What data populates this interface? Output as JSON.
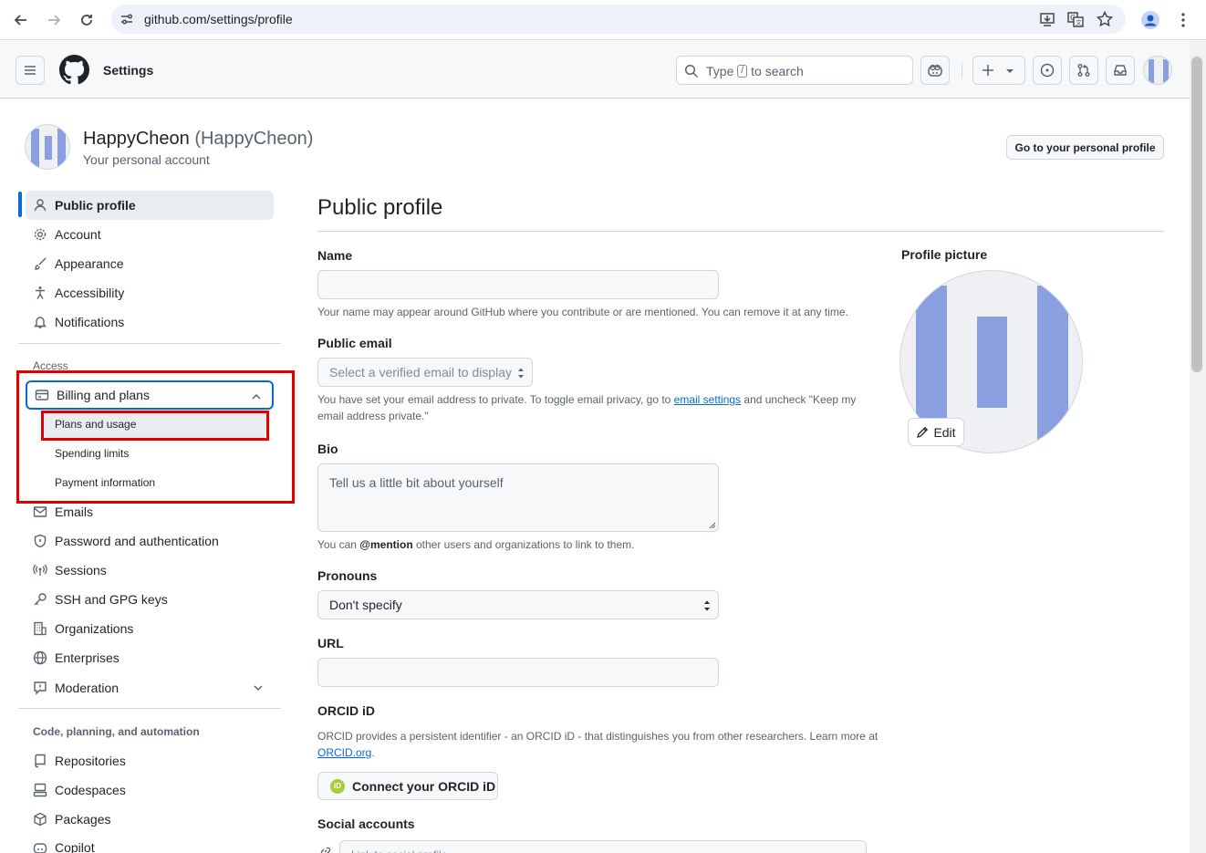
{
  "browser": {
    "url": "github.com/settings/profile"
  },
  "header": {
    "context": "Settings",
    "search_type": "Type",
    "search_key": "/",
    "search_rest": "to search"
  },
  "user": {
    "display_name": "HappyCheon",
    "login": "(HappyCheon)",
    "subtitle": "Your personal account",
    "go_profile_label": "Go to your personal profile"
  },
  "sidebar": {
    "top_items": [
      {
        "label": "Public profile",
        "icon": "person-icon"
      },
      {
        "label": "Account",
        "icon": "gear-icon"
      },
      {
        "label": "Appearance",
        "icon": "paintbrush-icon"
      },
      {
        "label": "Accessibility",
        "icon": "accessibility-icon"
      },
      {
        "label": "Notifications",
        "icon": "bell-icon"
      }
    ],
    "access_heading": "Access",
    "billing_label": "Billing and plans",
    "billing_sub": [
      "Plans and usage",
      "Spending limits",
      "Payment information"
    ],
    "access_items": [
      {
        "label": "Emails",
        "icon": "mail-icon"
      },
      {
        "label": "Password and authentication",
        "icon": "shield-lock-icon"
      },
      {
        "label": "Sessions",
        "icon": "broadcast-icon"
      },
      {
        "label": "SSH and GPG keys",
        "icon": "key-icon"
      },
      {
        "label": "Organizations",
        "icon": "organization-icon"
      },
      {
        "label": "Enterprises",
        "icon": "globe-icon"
      },
      {
        "label": "Moderation",
        "icon": "report-icon"
      }
    ],
    "code_heading": "Code, planning, and automation",
    "code_items": [
      {
        "label": "Repositories",
        "icon": "repo-icon"
      },
      {
        "label": "Codespaces",
        "icon": "codespaces-icon"
      },
      {
        "label": "Packages",
        "icon": "package-icon"
      },
      {
        "label": "Copilot",
        "icon": "copilot-icon"
      }
    ]
  },
  "main": {
    "title": "Public profile",
    "name_label": "Name",
    "name_value": "",
    "name_note": "Your name may appear around GitHub where you contribute or are mentioned. You can remove it at any time.",
    "email_label": "Public email",
    "email_select": "Select a verified email to display",
    "email_note_1": "You have set your email address to private. To toggle email privacy, go to",
    "email_note_link": "email settings",
    "email_note_2": "and uncheck \"Keep my",
    "email_note_3": "email address private.\"",
    "bio_label": "Bio",
    "bio_placeholder": "Tell us a little bit about yourself",
    "bio_note_1": "You can",
    "bio_note_mention": "@mention",
    "bio_note_2": "other users and organizations to link to them.",
    "pronouns_label": "Pronouns",
    "pronouns_value": "Don't specify",
    "url_label": "URL",
    "url_value": "",
    "orcid_label": "ORCID iD",
    "orcid_note_1": "ORCID provides a persistent identifier - an ORCID iD - that distinguishes you from other researchers. Learn more at",
    "orcid_note_link": "ORCID.org",
    "orcid_note_2": ".",
    "orcid_button": "Connect your ORCID iD",
    "orcid_badge": "iD",
    "social_label": "Social accounts",
    "social_placeholder": "Link to social profile"
  },
  "profile_picture": {
    "label": "Profile picture",
    "edit_label": "Edit"
  },
  "colors": {
    "accent": "#0969da",
    "highlight_box": "#e00000",
    "avatar_blue": "#8a9fe0"
  }
}
